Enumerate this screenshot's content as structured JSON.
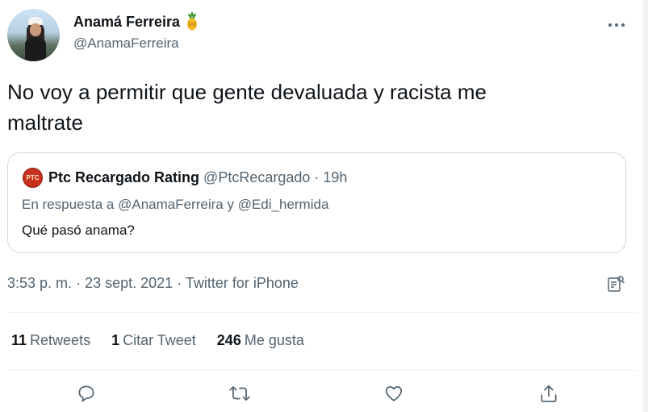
{
  "author": {
    "display_name": "Anamá Ferreira",
    "handle": "@AnamaFerreira",
    "emoji_icon": "pineapple-icon"
  },
  "tweet": {
    "text_line1": "No voy a permitir que gente devaluada y racista me",
    "text_line2": "maltrate"
  },
  "quoted_tweet": {
    "logo_text": "PTC",
    "display_name": "Ptc Recargado Rating",
    "handle": "@PtcRecargado",
    "separator": "·",
    "time": "19h",
    "reply_prefix": "En respuesta a",
    "reply_user1": "@AnamaFerreira",
    "reply_and": "y",
    "reply_user2": "@Edi_hermida",
    "text": "Qué pasó anama?"
  },
  "meta": {
    "time": "3:53 p. m.",
    "separator": "·",
    "date": "23 sept. 2021",
    "source": "Twitter for iPhone"
  },
  "stats": {
    "retweets_count": "11",
    "retweets_label": "Retweets",
    "quotes_count": "1",
    "quotes_label": "Citar Tweet",
    "likes_count": "246",
    "likes_label": "Me gusta"
  },
  "colors": {
    "text": "#0f1419",
    "secondary": "#536471",
    "border": "#cfd9de",
    "divider": "#eff3f4"
  }
}
